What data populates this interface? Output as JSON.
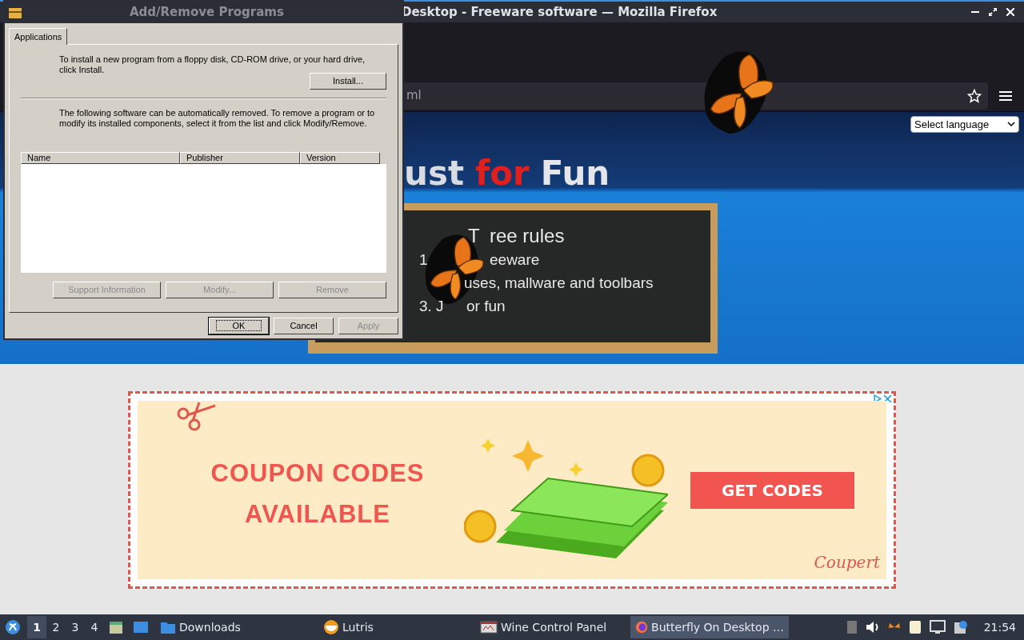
{
  "browser": {
    "title": "Desktop - Freeware software — Mozilla Firefox",
    "url": "ml",
    "language_select": "Select language",
    "heading": [
      {
        "text": "ust",
        "color": "#d8dce2"
      },
      {
        "text": "for",
        "color": "#e01f1f"
      },
      {
        "text": "Fun",
        "color": "#e4e6ea"
      }
    ],
    "board": {
      "lines": [
        [
          "T",
          "ree rules"
        ],
        [
          "1",
          "eeware"
        ],
        [
          "uses, mallware and toolbars"
        ],
        [
          "3. J",
          "or fun"
        ]
      ]
    },
    "ad": {
      "headline": [
        "COUPON CODES",
        "AVAILABLE"
      ],
      "button": "GET CODES",
      "brand": "Coupert"
    }
  },
  "dialog": {
    "title": "Add/Remove Programs",
    "tabs": [
      {
        "label": "Applications",
        "selected": true
      }
    ],
    "install_text": "To install a new program from a floppy disk, CD-ROM drive, or your hard drive, click Install.",
    "install_button": {
      "label": "Install...",
      "disabled": false
    },
    "remove_text": "The following software can be automatically removed. To remove a program or to modify its installed components, select it from the list and click Modify/Remove.",
    "columns": [
      "Name",
      "Publisher",
      "Version"
    ],
    "list_buttons": [
      {
        "label": "Support Information",
        "disabled": true
      },
      {
        "label": "Modify...",
        "disabled": true
      },
      {
        "label": "Remove",
        "disabled": true
      }
    ],
    "buttons": [
      {
        "label": "OK",
        "disabled": false,
        "focused": true
      },
      {
        "label": "Cancel",
        "disabled": false,
        "focused": false
      },
      {
        "label": "Apply",
        "disabled": true,
        "focused": false
      }
    ]
  },
  "taskbar": {
    "workspaces": [
      {
        "label": "1",
        "selected": true
      },
      {
        "label": "2",
        "selected": false
      },
      {
        "label": "3",
        "selected": false
      },
      {
        "label": "4",
        "selected": false
      }
    ],
    "tasks": [
      {
        "label": "Downloads",
        "kind": "folder",
        "selected": false
      },
      {
        "label": "Lutris",
        "kind": "lutris",
        "selected": false
      },
      {
        "label": "Wine Control Panel",
        "kind": "wine",
        "selected": false
      },
      {
        "label": "Butterfly On Desktop …",
        "kind": "firefox",
        "selected": true
      }
    ],
    "clock": "21:54"
  }
}
